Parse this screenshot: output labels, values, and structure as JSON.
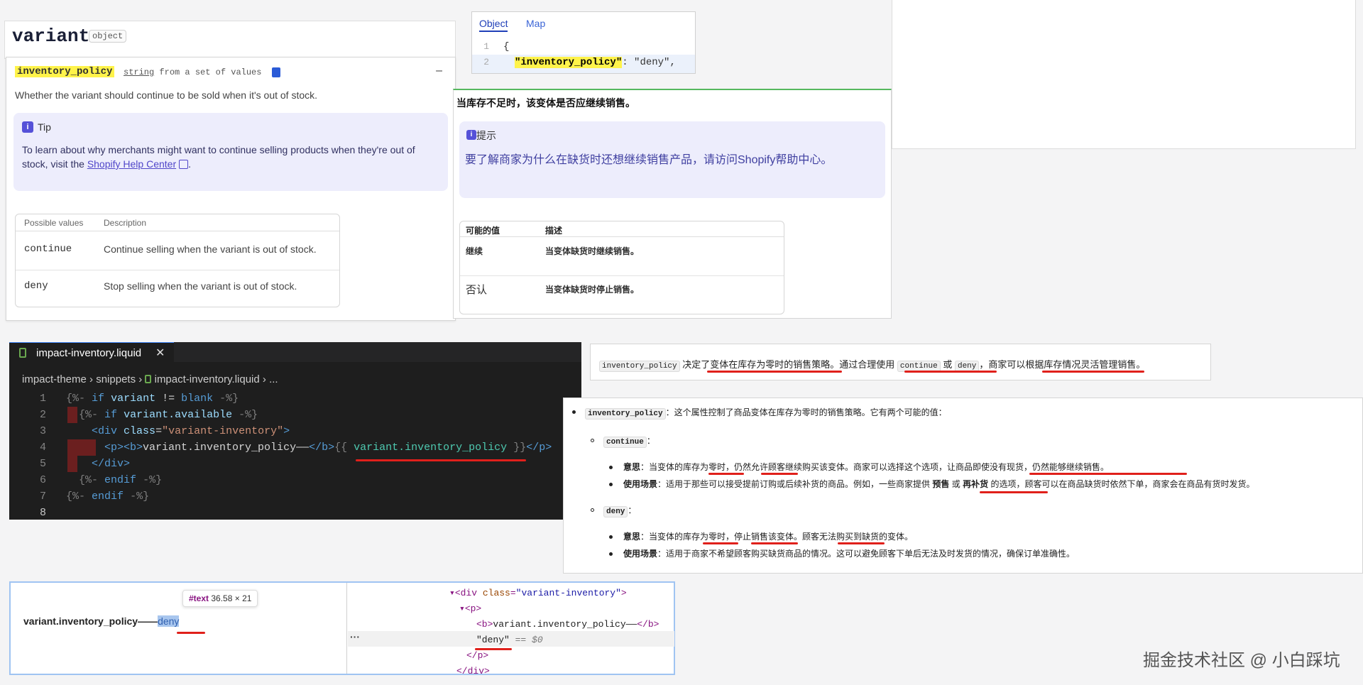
{
  "docs_en": {
    "title": "variant",
    "badge": "object",
    "property": "inventory_policy",
    "type_kw": "string",
    "type_rest": "from a set of values",
    "collapse": "–",
    "description": "Whether the variant should continue to be sold when it's out of stock.",
    "tip_title": "Tip",
    "tip_text": "To learn about why merchants might want to continue selling products when they're out of stock, visit the",
    "tip_link": "Shopify Help Center",
    "tip_end": ".",
    "table_head": [
      "Possible values",
      "Description"
    ],
    "rows": [
      {
        "value": "continue",
        "desc": "Continue selling when the variant is out of stock."
      },
      {
        "value": "deny",
        "desc": "Stop selling when the variant is out of stock."
      }
    ]
  },
  "json_panel": {
    "tabs": [
      "Object",
      "Map"
    ],
    "line_numbers": [
      "1",
      "2"
    ],
    "line1": "{",
    "key": "\"inventory_policy\"",
    "value": ": \"deny\","
  },
  "docs_zh": {
    "description": "当库存不足时，该变体是否应继续销售。",
    "tip_title": "提示",
    "tip_text": "要了解商家为什么在缺货时还想继续销售产品，请访问Shopify帮助中心。",
    "table_head": [
      "可能的值",
      "描述"
    ],
    "rows": [
      {
        "value": "继续",
        "desc": "当变体缺货时继续销售。"
      },
      {
        "value": "否认",
        "desc": "当变体缺货时停止销售。"
      }
    ]
  },
  "editor": {
    "tab_name": "impact-inventory.liquid",
    "close": "✕",
    "crumbs": [
      "impact-theme",
      "snippets",
      "impact-inventory.liquid",
      "..."
    ],
    "line_numbers": [
      "1",
      "2",
      "3",
      "4",
      "5",
      "6",
      "7",
      "8"
    ]
  },
  "summary": {
    "code1": "inventory_policy",
    "text1": "决定了变体在库存为零时的销售策略。通过合理使用",
    "code2": "continue",
    "or": "或",
    "code3": "deny",
    "text2": "，商家可以根据库存情况灵活管理销售。"
  },
  "explain": {
    "head_code": "inventory_policy",
    "head_text": "：这个属性控制了商品变体在库存为零时的销售策略。它有两个可能的值：",
    "continue_code": "continue",
    "deny_code": "deny",
    "colon": "：",
    "meaning_label": "意思",
    "usage_label": "使用场景",
    "c_meaning": "：当变体的库存为零时，仍然允许顾客继续购买该变体。商家可以选择这个选项，让商品即使没有现货，仍然能够继续销售。",
    "c_usage_a": "：适用于那些可以接受提前订购或后续补货的商品。例如，一些商家提供",
    "c_usage_b1": "预售",
    "c_usage_or": "或",
    "c_usage_b2": "再补货",
    "c_usage_c": "的选项，顾客可以在商品缺货时依然下单，商家会在商品有货时发货。",
    "d_meaning": "：当变体的库存为零时，停止销售该变体。顾客无法购买到缺货的变体。",
    "d_usage": "：适用于商家不希望顾客购买缺货商品的情况。这可以避免顾客下单后无法及时发货的情况，确保订单准确性。"
  },
  "devtools": {
    "tip_node": "#text",
    "tip_size": "36.58 × 21",
    "render_prefix": "variant.inventory_policy——",
    "render_value": "deny",
    "dom_l1_tag": "<div ",
    "dom_l1_attr": "class",
    "dom_l1_val": "\"variant-inventory\"",
    "dom_l1_end": ">",
    "dom_l2": "<p>",
    "dom_l3_open": "<b>",
    "dom_l3_text": "variant.inventory_policy——",
    "dom_l3_close": "</b>",
    "dom_l4_text": "\"deny\"",
    "dom_l4_cmt": "== $0",
    "dom_l5": "</p>",
    "dom_l6": "</div>",
    "more": "···"
  },
  "watermark": "掘金技术社区 @ 小白踩坑",
  "colors": {
    "highlight": "#fff34a",
    "tip_bg": "#ededfc",
    "editor_bg": "#1e1e1e",
    "annotation_red": "#e0201b"
  }
}
